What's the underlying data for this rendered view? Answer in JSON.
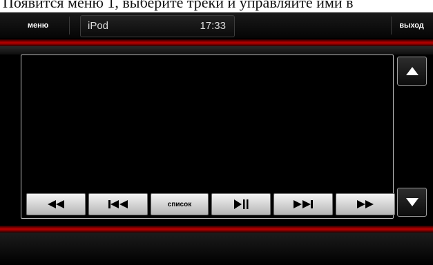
{
  "caption": {
    "text": "Появится меню 1, выберите треки и управляйте ими в"
  },
  "header": {
    "menu_label": "меню",
    "source_label": "iPod",
    "time": "17:33",
    "exit_label": "выход"
  },
  "controls": {
    "list_label": "список"
  },
  "colors": {
    "accent_red": "#b10000",
    "background": "#000000",
    "button_face": "#d8d8d8"
  }
}
